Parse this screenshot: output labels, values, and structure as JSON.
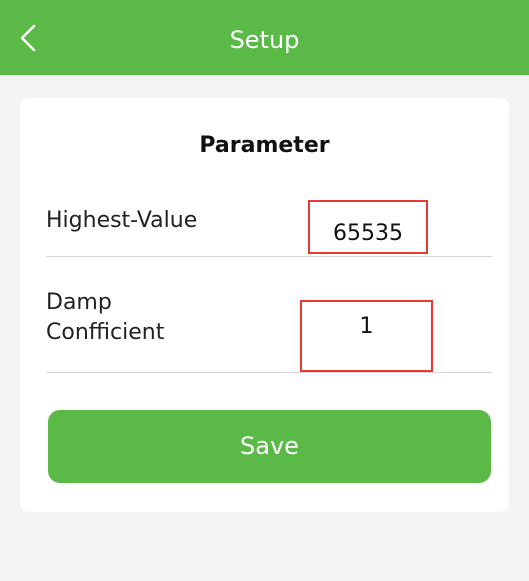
{
  "header": {
    "title": "Setup"
  },
  "card": {
    "section_title": "Parameter",
    "rows": [
      {
        "label": "Highest-Value",
        "value": "65535"
      },
      {
        "label": "Damp\nConfficient",
        "value": "1"
      }
    ],
    "save_label": "Save"
  },
  "colors": {
    "primary": "#5bba47",
    "highlight_border": "#e53935",
    "background": "#f4f4f4",
    "card": "#ffffff"
  },
  "icons": {
    "back": "chevron-left-icon"
  }
}
